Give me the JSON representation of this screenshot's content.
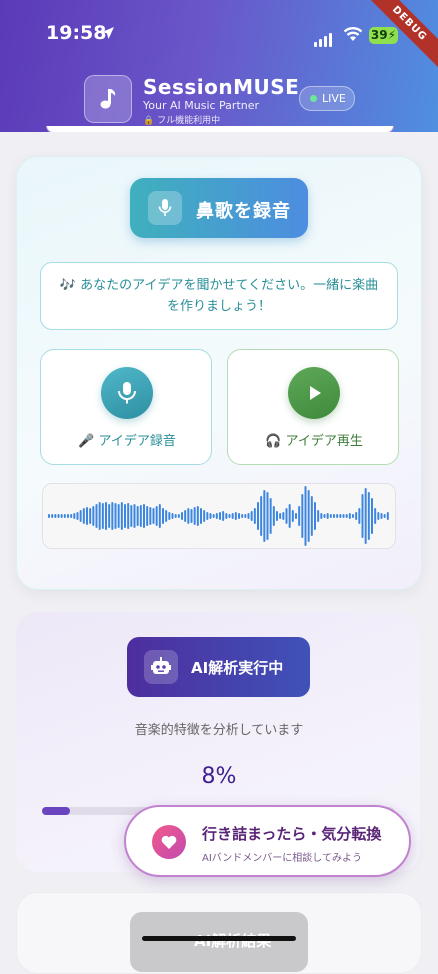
{
  "status_bar": {
    "time": "19:58",
    "battery": "39"
  },
  "debug_banner": "DEBUG",
  "header": {
    "title": "SessionMUSE",
    "subtitle": "Your AI Music Partner",
    "feature_note": "フル機能利用中",
    "live_label": "LIVE"
  },
  "record_card": {
    "record_button_label": "鼻歌を録音",
    "message": "🎶 あなたのアイデアを聞かせてください。一緒に楽曲を作りましょう！",
    "idea_record_label": "🎤 アイデア録音",
    "idea_play_label": "🎧 アイデア再生"
  },
  "analysis_card": {
    "button_label": "AI解析実行中",
    "status_text": "音楽的特徴を分析しています",
    "progress_text": "8%",
    "progress_value": 8
  },
  "result_card": {
    "button_label": "AI解析結果"
  },
  "fab": {
    "title": "行き詰まったら・気分転換",
    "subtitle": "AIバンドメンバーに相談してみよう"
  },
  "colors": {
    "accent": "#4d8de0",
    "analysis": "#4e2e9e",
    "waveform": "#3d86e0"
  }
}
